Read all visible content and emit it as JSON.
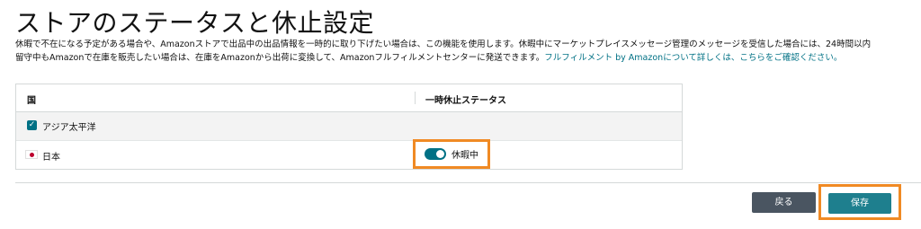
{
  "page": {
    "title": "ストアのステータスと休止設定",
    "description_line1": "休暇で不在になる予定がある場合や、Amazonストアで出品中の出品情報を一時的に取り下げたい場合は、この機能を使用します。休暇中にマーケットプレイスメッセージ管理のメッセージを受信した場合には、24時間以内",
    "description_line2": "留守中もAmazonで在庫を販売したい場合は、在庫をAmazonから出荷に変換して、Amazonフルフィルメントセンターに発送できます。",
    "description_link": "フルフィルメント by Amazonについて詳しくは、こちらをご確認ください。"
  },
  "table": {
    "headers": {
      "country": "国",
      "status": "一時休止ステータス"
    },
    "group": {
      "label": "アジア太平洋",
      "checked": true
    },
    "rows": [
      {
        "country": "日本",
        "flag": "japan-flag-icon",
        "toggle_on": true,
        "status_label": "休暇中"
      }
    ]
  },
  "actions": {
    "back_label": "戻る",
    "save_label": "保存"
  },
  "colors": {
    "accent": "#007185",
    "highlight": "#f08a24",
    "back_button": "#4a5561",
    "save_button": "#1e7f8e"
  }
}
